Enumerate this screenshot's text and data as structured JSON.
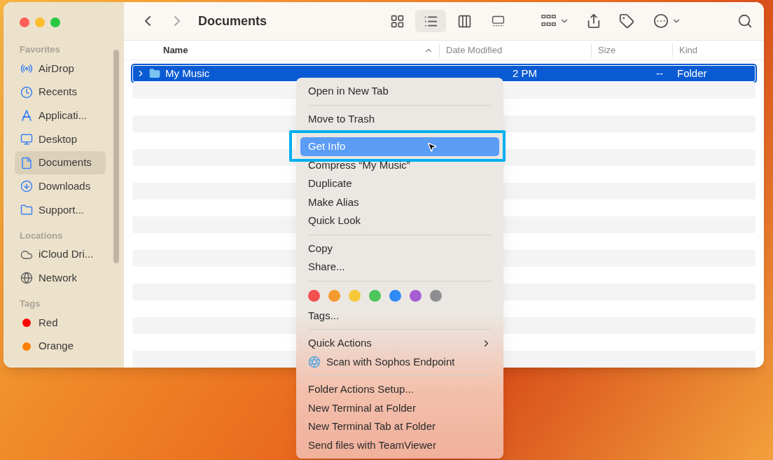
{
  "window": {
    "title": "Documents"
  },
  "toolbar": {
    "view_modes": [
      {
        "kind": "icons",
        "selected": false
      },
      {
        "kind": "list",
        "selected": true
      },
      {
        "kind": "columns",
        "selected": false
      },
      {
        "kind": "gallery",
        "selected": false
      }
    ]
  },
  "sidebar": {
    "sections": [
      {
        "title": "Favorites",
        "items": [
          {
            "label": "AirDrop",
            "kind": "airdrop",
            "selected": false
          },
          {
            "label": "Recents",
            "kind": "recents",
            "selected": false
          },
          {
            "label": "Applicati...",
            "kind": "applications",
            "selected": false
          },
          {
            "label": "Desktop",
            "kind": "desktop",
            "selected": false
          },
          {
            "label": "Documents",
            "kind": "documents",
            "selected": true
          },
          {
            "label": "Downloads",
            "kind": "downloads",
            "selected": false
          },
          {
            "label": "Support...",
            "kind": "folder",
            "selected": false
          }
        ]
      },
      {
        "title": "Locations",
        "items": [
          {
            "label": "iCloud Dri...",
            "kind": "icloud",
            "selected": false
          },
          {
            "label": "Network",
            "kind": "network",
            "selected": false
          }
        ]
      },
      {
        "title": "Tags",
        "items": [
          {
            "label": "Red",
            "kind": "tag",
            "color": "#ff0000",
            "selected": false
          },
          {
            "label": "Orange",
            "kind": "tag",
            "color": "#ff8000",
            "selected": false
          }
        ]
      }
    ]
  },
  "table": {
    "columns": [
      {
        "label": "Name",
        "sorted": true
      },
      {
        "label": "Date Modified",
        "sorted": false
      },
      {
        "label": "Size",
        "sorted": false
      },
      {
        "label": "Kind",
        "sorted": false
      }
    ],
    "rows": [
      {
        "name": "My Music",
        "date": "2 PM",
        "size": "--",
        "kind": "Folder",
        "selected": true,
        "expanded": false
      }
    ]
  },
  "context_menu": {
    "groups": [
      [
        {
          "kind": "item",
          "label": "Open in New Tab",
          "highlighted": false,
          "outlined": false
        }
      ],
      [
        {
          "kind": "item",
          "label": "Move to Trash",
          "highlighted": false,
          "outlined": false
        }
      ],
      [
        {
          "kind": "item",
          "label": "Get Info",
          "highlighted": true,
          "outlined": true
        },
        {
          "kind": "item",
          "label": "Compress “My Music”",
          "highlighted": false,
          "outlined": false
        },
        {
          "kind": "item",
          "label": "Duplicate",
          "highlighted": false,
          "outlined": false
        },
        {
          "kind": "item",
          "label": "Make Alias",
          "highlighted": false,
          "outlined": false
        },
        {
          "kind": "item",
          "label": "Quick Look",
          "highlighted": false,
          "outlined": false
        }
      ],
      [
        {
          "kind": "item",
          "label": "Copy",
          "highlighted": false,
          "outlined": false
        },
        {
          "kind": "item",
          "label": "Share...",
          "highlighted": false,
          "outlined": false
        }
      ],
      [
        {
          "kind": "colors",
          "tags": [
            {
              "color": "#f0504f"
            },
            {
              "color": "#f59a30"
            },
            {
              "color": "#f6c93a"
            },
            {
              "color": "#4cc55a"
            },
            {
              "color": "#2f8af5"
            },
            {
              "color": "#a65dd3"
            },
            {
              "color": "#8e8e92"
            }
          ]
        },
        {
          "kind": "item",
          "label": "Tags...",
          "highlighted": false,
          "outlined": false
        }
      ],
      [
        {
          "kind": "submenu",
          "label": "Quick Actions",
          "highlighted": false,
          "outlined": false
        },
        {
          "kind": "icon_item",
          "label": "Scan with Sophos Endpoint",
          "highlighted": false,
          "outlined": false
        }
      ],
      [
        {
          "kind": "item",
          "label": "Folder Actions Setup...",
          "highlighted": false,
          "outlined": false
        },
        {
          "kind": "item",
          "label": "New Terminal at Folder",
          "highlighted": false,
          "outlined": false
        },
        {
          "kind": "item",
          "label": "New Terminal Tab at Folder",
          "highlighted": false,
          "outlined": false
        },
        {
          "kind": "item",
          "label": "Send files with TeamViewer",
          "highlighted": false,
          "outlined": false
        }
      ]
    ]
  }
}
